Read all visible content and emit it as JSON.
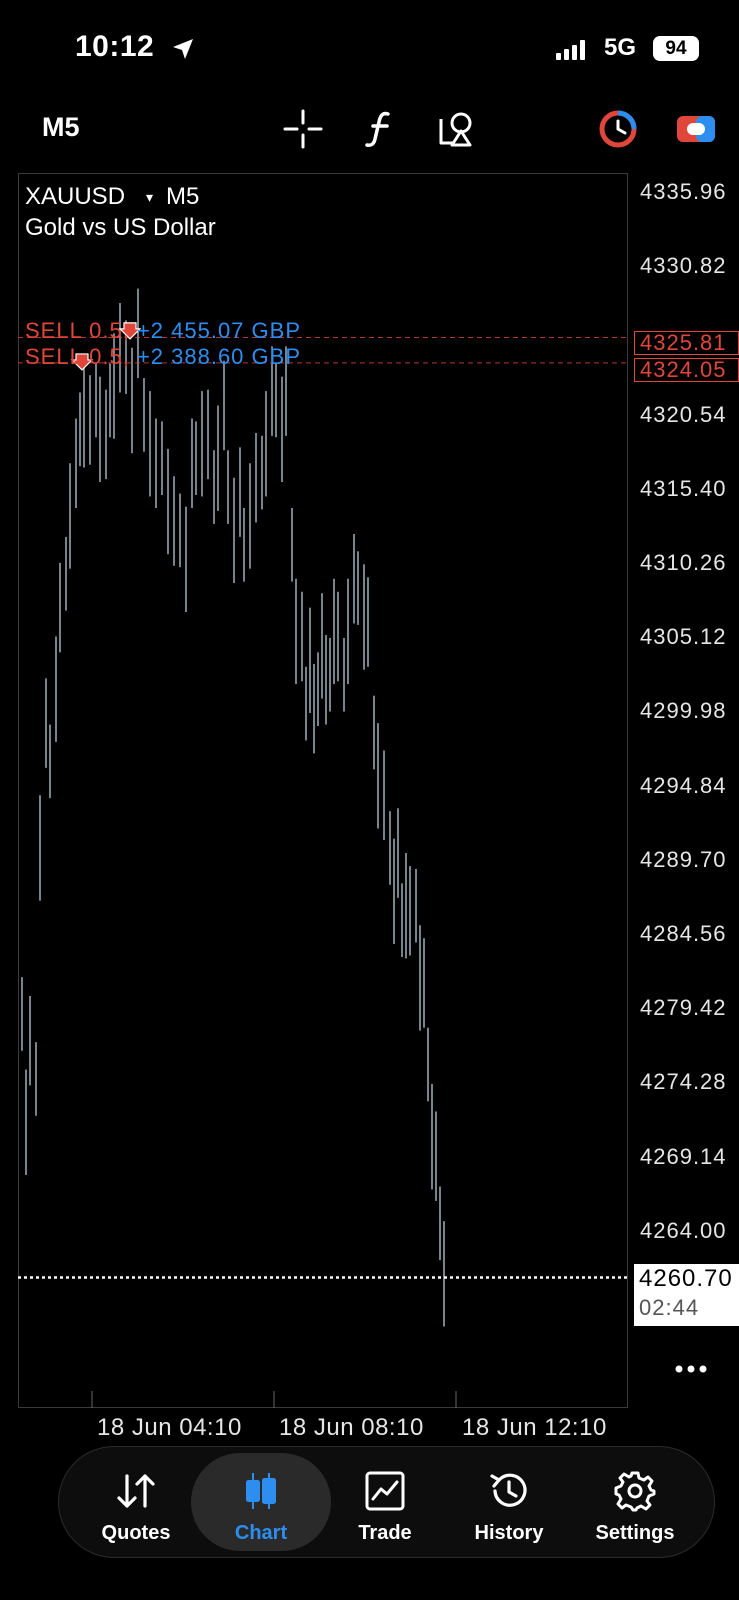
{
  "status_bar": {
    "time": "10:12",
    "network": "5G",
    "battery": "94"
  },
  "toolbar": {
    "timeframe": "M5",
    "icons": [
      "crosshair-icon",
      "function-icon",
      "objects-icon",
      "account-icon",
      "trade-toggle-icon"
    ]
  },
  "chart": {
    "symbol": "XAUUSD",
    "symbol_caret": "▾",
    "timeframe": "M5",
    "description": "Gold vs US Dollar",
    "trades": [
      {
        "side": "SELL 0.5,",
        "profit": "+2 455.07 GBP",
        "price": 4325.81,
        "price_label": "4325.81"
      },
      {
        "side": "SELL 0.5,",
        "profit": "+2 388.60 GBP",
        "price": 4324.05,
        "price_label": "4324.05"
      }
    ],
    "price_scale": [
      "4335.96",
      "4330.82",
      "4320.54",
      "4315.40",
      "4310.26",
      "4305.12",
      "4299.98",
      "4294.84",
      "4289.70",
      "4284.56",
      "4279.42",
      "4274.28",
      "4269.14",
      "4264.00"
    ],
    "current_price": {
      "value": 4260.7,
      "label": "4260.70",
      "timer": "02:44"
    },
    "time_axis": [
      "18 Jun 04:10",
      "18 Jun 08:10",
      "18 Jun 12:10"
    ],
    "colors": {
      "bar": "#a9bcc7",
      "sell": "#e0463a",
      "profit": "#2e8ef0",
      "current_line": "#ffffff"
    }
  },
  "nav": {
    "items": [
      {
        "label": "Quotes",
        "icon": "quotes-icon",
        "active": false
      },
      {
        "label": "Chart",
        "icon": "chart-icon",
        "active": true
      },
      {
        "label": "Trade",
        "icon": "trade-icon",
        "active": false
      },
      {
        "label": "History",
        "icon": "history-icon",
        "active": false
      },
      {
        "label": "Settings",
        "icon": "settings-icon",
        "active": false
      }
    ]
  }
}
